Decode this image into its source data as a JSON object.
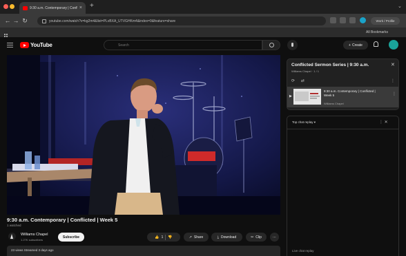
{
  "browser": {
    "tab_title": "9:30 a.m. Contemporary | Confli...",
    "url": "youtube.com/watch?v=kg2m4&list=PLvBXA_UTVGHKm4&index=9&feature=share",
    "profile_label": "Work / Profile",
    "bookmarks_other": "All Bookmarks"
  },
  "youtube": {
    "logo_text": "YouTube",
    "search_placeholder": "Search",
    "create_label": "Create"
  },
  "video": {
    "title": "9:30 a.m. Contemporary | Conflicted | Week 5",
    "subtitle": "1 watched",
    "channel_name": "Williams Chapel",
    "channel_subs": "1.27K subscribers",
    "subscribe_label": "Subscribe",
    "like_count": "1",
    "share_label": "Share",
    "download_label": "Download",
    "clip_label": "Clip",
    "description_stats": "23 views  Streamed 3 days ago"
  },
  "playlist": {
    "title": "Conflicted Sermon Series | 9:30 a.m.",
    "sub": "Williams Chapel · 1 / 1",
    "item_title": "9:30 a.m. Contemporary | Conflicted | Week 5",
    "item_channel": "Williams Chapel"
  },
  "chat": {
    "label": "Top chat replay ▾",
    "input_label": "Live chat replay"
  },
  "colors": {
    "accent": "#ff0000",
    "background": "#0f0f0f",
    "avatar": "#1aa39a"
  }
}
